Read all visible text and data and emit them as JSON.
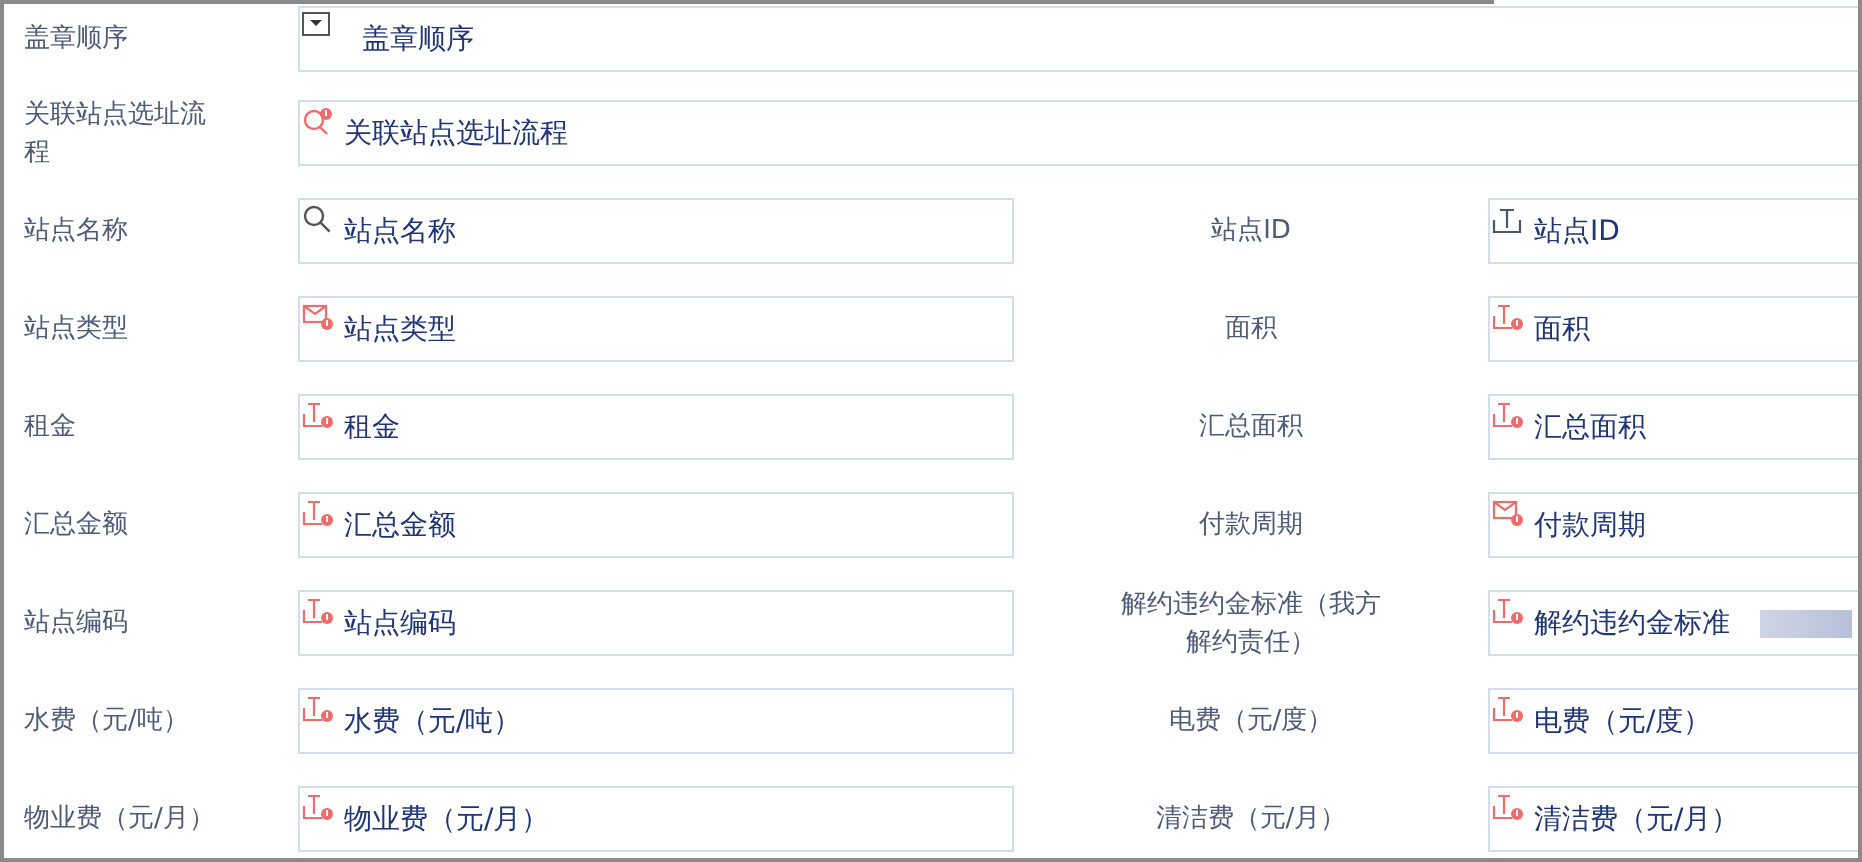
{
  "rows": [
    {
      "fields": [
        {
          "label": "盖章顺序",
          "kind": "dropdown",
          "placeholder": "盖章顺序"
        }
      ]
    },
    {
      "fields": [
        {
          "label": "关联站点选址流程",
          "kind": "lookup-required",
          "placeholder": "关联站点选址流程"
        }
      ]
    },
    {
      "fields": [
        {
          "label": "站点名称",
          "kind": "search",
          "placeholder": "站点名称"
        },
        {
          "label": "站点ID",
          "kind": "text",
          "placeholder": "站点ID"
        }
      ]
    },
    {
      "fields": [
        {
          "label": "站点类型",
          "kind": "select-required",
          "placeholder": "站点类型"
        },
        {
          "label": "面积",
          "kind": "text-required",
          "placeholder": "面积"
        }
      ]
    },
    {
      "fields": [
        {
          "label": "租金",
          "kind": "text-required",
          "placeholder": "租金"
        },
        {
          "label": "汇总面积",
          "kind": "text-required",
          "placeholder": "汇总面积"
        }
      ]
    },
    {
      "fields": [
        {
          "label": "汇总金额",
          "kind": "text-required",
          "placeholder": "汇总金额"
        },
        {
          "label": "付款周期",
          "kind": "select-required",
          "placeholder": "付款周期"
        }
      ]
    },
    {
      "fields": [
        {
          "label": "站点编码",
          "kind": "text-required",
          "placeholder": "站点编码"
        },
        {
          "label": "解约违约金标准（我方解约责任）",
          "kind": "text-required",
          "placeholder": "解约违约金标准",
          "obscured": true
        }
      ]
    },
    {
      "fields": [
        {
          "label": "水费（元/吨）",
          "kind": "text-required",
          "placeholder": "水费（元/吨）"
        },
        {
          "label": "电费（元/度）",
          "kind": "text-required",
          "placeholder": "电费（元/度）"
        }
      ]
    },
    {
      "fields": [
        {
          "label": "物业费（元/月）",
          "kind": "text-required",
          "placeholder": "物业费（元/月）"
        },
        {
          "label": "清洁费（元/月）",
          "kind": "text-required",
          "placeholder": "清洁费（元/月）"
        }
      ]
    }
  ]
}
